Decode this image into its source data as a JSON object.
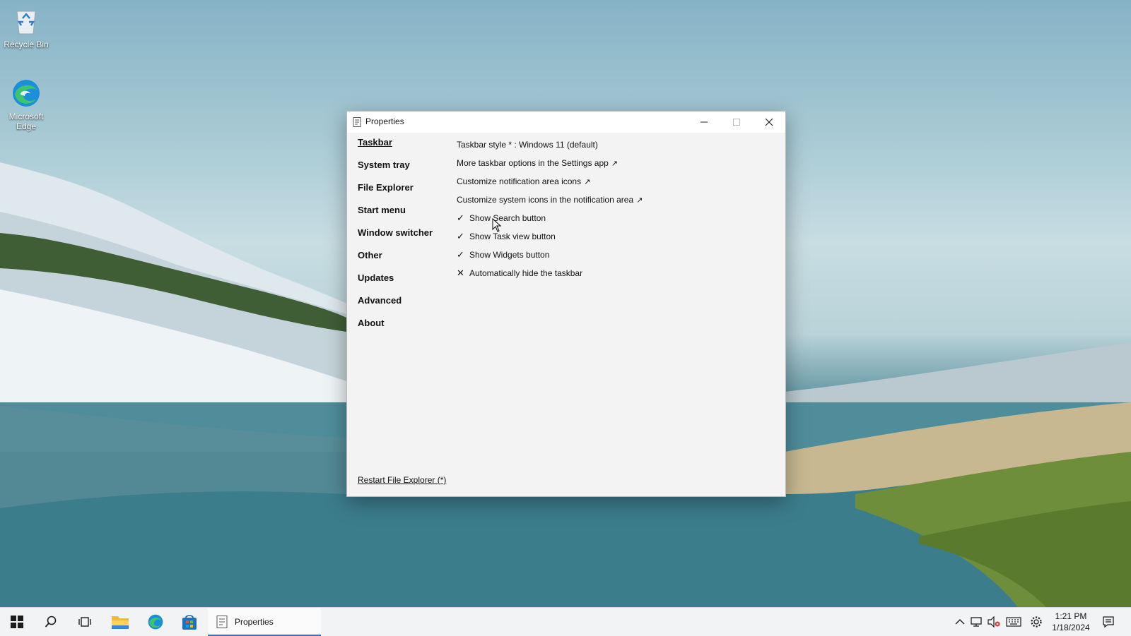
{
  "desktop": {
    "icons": [
      {
        "label": "Recycle Bin",
        "icon": "recycle-bin-icon"
      },
      {
        "label": "Microsoft Edge",
        "icon": "edge-icon"
      }
    ]
  },
  "window": {
    "title": "Properties",
    "nav": [
      {
        "label": "Taskbar",
        "active": true
      },
      {
        "label": "System tray"
      },
      {
        "label": "File Explorer"
      },
      {
        "label": "Start menu"
      },
      {
        "label": "Window switcher"
      },
      {
        "label": "Other"
      },
      {
        "label": "Updates"
      },
      {
        "label": "Advanced"
      },
      {
        "label": "About"
      }
    ],
    "settings": [
      {
        "text": "Taskbar style * : Windows 11 (default)"
      },
      {
        "text": "More taskbar options in the Settings app",
        "ext": "↗"
      },
      {
        "text": "Customize notification area icons",
        "ext": "↗"
      },
      {
        "text": "Customize system icons in the notification area",
        "ext": "↗"
      },
      {
        "mark": "✓",
        "text": "Show Search button"
      },
      {
        "mark": "✓",
        "text": "Show Task view button"
      },
      {
        "mark": "✓",
        "text": "Show Widgets button"
      },
      {
        "mark": "✕",
        "text": "Automatically hide the taskbar"
      }
    ],
    "footer_link": "Restart File Explorer (*)"
  },
  "taskbar": {
    "running_app": "Properties",
    "clock": {
      "time": "1:21 PM",
      "date": "1/18/2024"
    },
    "accent": "#2e6fd1"
  }
}
